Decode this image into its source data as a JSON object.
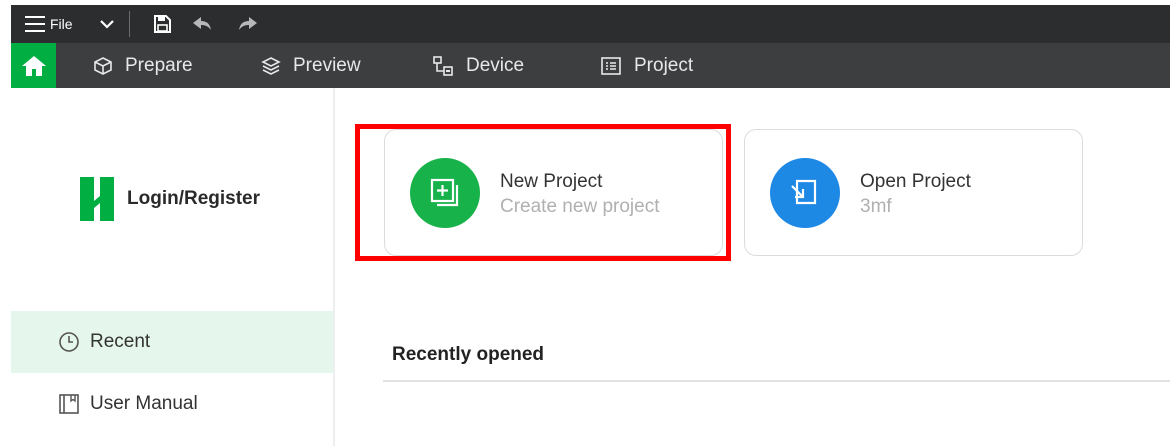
{
  "titlebar": {
    "file_label": "File",
    "icons": [
      "hamburger-icon",
      "chevron-down-icon",
      "save-icon",
      "undo-icon",
      "redo-icon"
    ]
  },
  "menubar": {
    "items": [
      {
        "label": "Prepare",
        "icon": "cube-icon"
      },
      {
        "label": "Preview",
        "icon": "layers-icon"
      },
      {
        "label": "Device",
        "icon": "device-icon"
      },
      {
        "label": "Project",
        "icon": "project-list-icon"
      }
    ]
  },
  "sidebar": {
    "login_label": "Login/Register",
    "items": [
      {
        "label": "Recent",
        "icon": "clock-icon",
        "active": true
      },
      {
        "label": "User Manual",
        "icon": "book-icon",
        "active": false
      }
    ]
  },
  "cards": {
    "new_project": {
      "title": "New Project",
      "subtitle": "Create new project",
      "color": "#18b24b"
    },
    "open_project": {
      "title": "Open Project",
      "subtitle": "3mf",
      "color": "#1e88e5"
    }
  },
  "recent": {
    "title": "Recently opened"
  },
  "colors": {
    "brand": "#00ae42",
    "highlight": "#ff0000",
    "topbar": "#2b2d2f",
    "menubar": "#3c3e40"
  }
}
